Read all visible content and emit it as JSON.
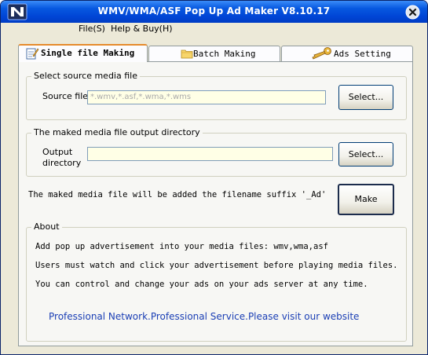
{
  "window": {
    "title": "WMV/WMA/ASF Pop Up Ad Maker V8.10.17"
  },
  "menu": {
    "file": "File(S)",
    "help": "Help & Buy(H)"
  },
  "tabs": [
    {
      "label": "Single file Making",
      "icon": "document-pen-icon",
      "active": true
    },
    {
      "label": "Batch Making",
      "icon": "folder-icon",
      "active": false
    },
    {
      "label": "Ads Setting",
      "icon": "key-icon",
      "active": false
    }
  ],
  "source": {
    "group_title": "Select source media file",
    "label": "Source file",
    "placeholder": "*.wmv,*.asf,*.wma,*.wms",
    "value": "",
    "button": "Select..."
  },
  "output": {
    "group_title": "The maked media file output directory",
    "label_line1": "Output",
    "label_line2": "directory",
    "value": "",
    "button": "Select..."
  },
  "make": {
    "note": "The maked media file will be added the filename suffix '_Ad'",
    "button": "Make"
  },
  "about": {
    "group_title": "About",
    "lines": [
      "Add pop up advertisement into your media files: wmv,wma,asf",
      "Users must watch and click your advertisement before playing media files.",
      "You can control and change your ads on your ads server at any time."
    ],
    "link": "Professional Network.Professional Service.Please visit our website"
  },
  "colors": {
    "titlebar": "#0054e3",
    "link": "#1b3fb5",
    "input_bg": "#ffffe6"
  }
}
